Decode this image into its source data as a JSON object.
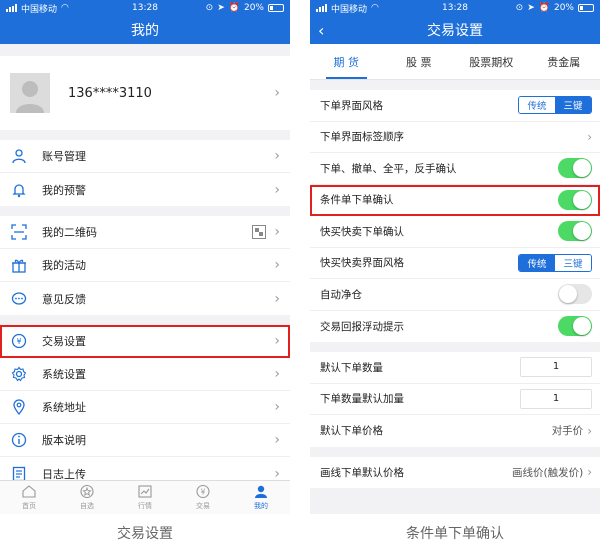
{
  "status": {
    "carrier": "中国移动",
    "time": "13:28",
    "battery": "20%"
  },
  "left": {
    "title": "我的",
    "phone": "136****3110",
    "group1": [
      {
        "label": "账号管理",
        "icon": "user-icon"
      },
      {
        "label": "我的预警",
        "icon": "bell-icon"
      }
    ],
    "group2": [
      {
        "label": "我的二维码",
        "icon": "scan-icon"
      },
      {
        "label": "我的活动",
        "icon": "gift-icon"
      },
      {
        "label": "意见反馈",
        "icon": "chat-icon"
      }
    ],
    "group3": [
      {
        "label": "交易设置",
        "icon": "yen-icon"
      },
      {
        "label": "系统设置",
        "icon": "gear-icon"
      },
      {
        "label": "系统地址",
        "icon": "pin-icon"
      },
      {
        "label": "版本说明",
        "icon": "info-icon"
      },
      {
        "label": "日志上传",
        "icon": "upload-icon"
      }
    ],
    "tabs": [
      {
        "label": "首页",
        "icon": "home-icon"
      },
      {
        "label": "自选",
        "icon": "star-icon"
      },
      {
        "label": "行情",
        "icon": "chart-icon"
      },
      {
        "label": "交易",
        "icon": "yen-icon"
      },
      {
        "label": "我的",
        "icon": "person-icon"
      }
    ],
    "caption": "交易设置"
  },
  "right": {
    "title": "交易设置",
    "tabs": [
      "期 货",
      "股 票",
      "股票期权",
      "贵金属"
    ],
    "rows1": {
      "order_style": "下单界面风格",
      "opt_a": "传统",
      "opt_b": "三键",
      "tab_order": "下单界面标签顺序",
      "confirm": "下单、撤单、全平，反手确认",
      "cond_confirm": "条件单下单确认",
      "quick_confirm": "快买快卖下单确认",
      "quick_style": "快买快卖界面风格",
      "auto_close": "自动净仓",
      "float_tip": "交易回报浮动提示"
    },
    "rows2": {
      "default_qty": "默认下单数量",
      "default_qty_val": "1",
      "qty_step": "下单数量默认加量",
      "qty_step_val": "1",
      "default_price": "默认下单价格",
      "default_price_val": "对手价"
    },
    "rows3": {
      "line_price": "画线下单默认价格",
      "line_price_val": "画线价(触发价)"
    },
    "caption": "条件单下单确认"
  },
  "colors": {
    "accent": "#1e6fd9",
    "toggle_on": "#4cd964",
    "highlight": "#e0201e"
  }
}
